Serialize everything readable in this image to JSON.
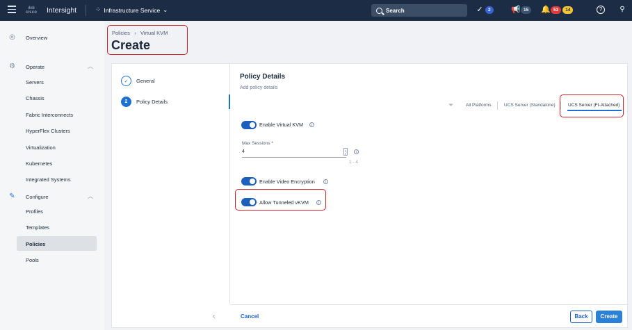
{
  "topbar": {
    "brand": "cisco",
    "app_name": "Intersight",
    "service": "Infrastructure Service",
    "search_label": "Search",
    "tasks_count": "2",
    "announcements_count": "15",
    "alarms_critical": "53",
    "alarms_warning": "14",
    "icons": [
      "menu-icon",
      "apps-grid-icon",
      "chevron-down-icon",
      "search-icon",
      "check-circle-icon",
      "megaphone-icon",
      "bell-icon",
      "help-icon",
      "user-icon"
    ]
  },
  "sidebar": {
    "overview": "Overview",
    "operate": "Operate",
    "operate_items": [
      "Servers",
      "Chassis",
      "Fabric Interconnects",
      "HyperFlex Clusters",
      "Virtualization",
      "Kubernetes",
      "Integrated Systems"
    ],
    "configure": "Configure",
    "configure_items": [
      "Profiles",
      "Templates",
      "Policies",
      "Pools"
    ],
    "selected": "Policies"
  },
  "header": {
    "breadcrumb_root": "Policies",
    "breadcrumb_current": "Virtual KVM",
    "title": "Create"
  },
  "steps": [
    {
      "number": "1",
      "label": "General",
      "state": "done"
    },
    {
      "number": "2",
      "label": "Policy Details",
      "state": "active"
    }
  ],
  "details": {
    "title": "Policy Details",
    "subtitle": "Add policy details",
    "platforms": [
      "All Platforms",
      "UCS Server (Standalone)",
      "UCS Server (FI-Attached)"
    ],
    "selected_platform": "UCS Server (FI-Attached)",
    "enable_virtual_kvm": "Enable Virtual KVM",
    "max_sessions_label": "Max Sessions *",
    "max_sessions_value": "4",
    "max_sessions_hint": "1 - 4",
    "enable_video_encryption": "Enable Video Encryption",
    "allow_tunneled_vkvm": "Allow Tunneled vKVM",
    "toggles_on": [
      true,
      true,
      true
    ]
  },
  "footer": {
    "cancel": "Cancel",
    "back": "Back",
    "create": "Create"
  },
  "colors": {
    "topbar_bg": "#1c2c44",
    "accent": "#1c6fd1",
    "highlight_box": "#d0202a"
  }
}
